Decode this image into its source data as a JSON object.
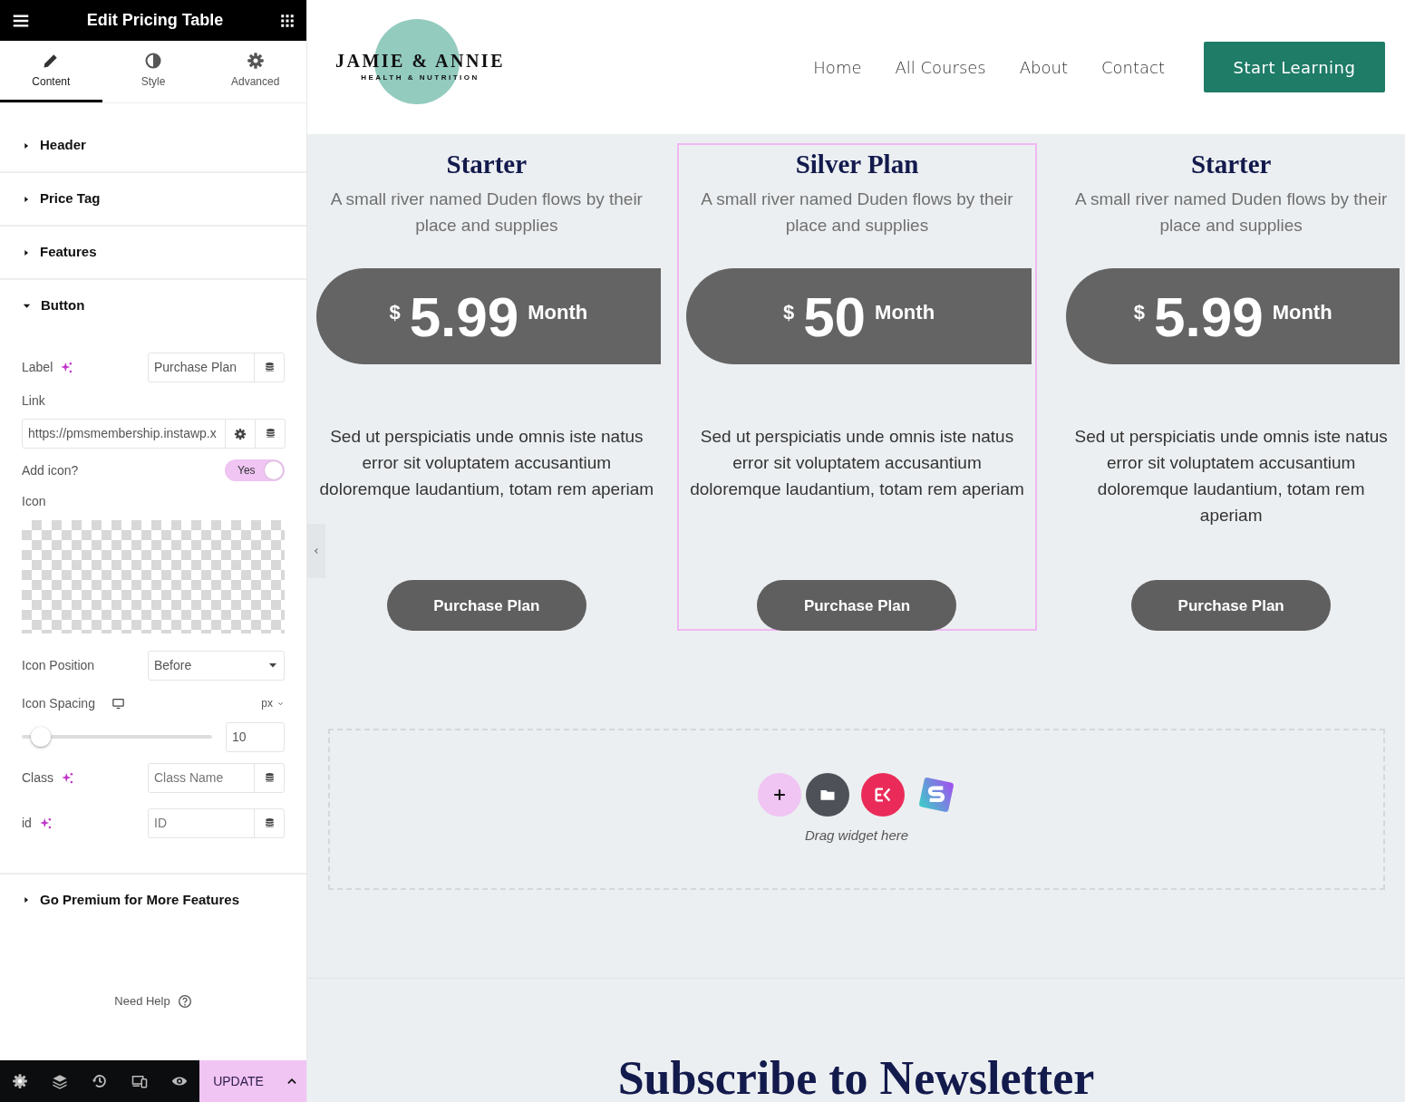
{
  "panel": {
    "title": "Edit Pricing Table",
    "tabs": [
      {
        "label": "Content",
        "kind": "pencil",
        "selected": true
      },
      {
        "label": "Style",
        "kind": "contrast",
        "selected": false
      },
      {
        "label": "Advanced",
        "kind": "gear",
        "selected": false
      }
    ],
    "sections": [
      {
        "title": "Header",
        "expanded": false
      },
      {
        "title": "Price Tag",
        "expanded": false
      },
      {
        "title": "Features",
        "expanded": false
      },
      {
        "title": "Button",
        "expanded": true
      }
    ],
    "button_controls": {
      "label": {
        "label": "Label",
        "value": "Purchase Plan"
      },
      "link": {
        "label": "Link",
        "value": "https://pmsmembership.instawp.x"
      },
      "add_icon": {
        "label": "Add icon?",
        "on": true,
        "text": "Yes"
      },
      "icon": {
        "label": "Icon"
      },
      "icon_position": {
        "label": "Icon Position",
        "value": "Before"
      },
      "icon_spacing": {
        "label": "Icon Spacing",
        "unit": "px",
        "value": "10",
        "level": 0.1
      },
      "class": {
        "label": "Class",
        "placeholder": "Class Name"
      },
      "id": {
        "label": "id",
        "placeholder": "ID"
      }
    },
    "premium": {
      "title": "Go Premium for More Features",
      "expanded": false
    },
    "help": "Need Help",
    "update": "UPDATE"
  },
  "site": {
    "logo": {
      "name": "JAMIE & ANNIE",
      "tagline": "HEALTH & NUTRITION"
    },
    "nav": [
      "Home",
      "All Courses",
      "About",
      "Contact"
    ],
    "cta": "Start Learning",
    "plans": [
      {
        "title": "Starter",
        "description": "A small river named Duden flows by their place and supplies",
        "currency": "$",
        "price": "5.99",
        "period": "Month",
        "features": "Sed ut perspiciatis unde omnis iste natus error sit voluptatem accusantium doloremque laudantium, totam rem aperiam",
        "button": "Purchase Plan",
        "selected": false
      },
      {
        "title": "Silver Plan",
        "description": "A small river named Duden flows by their place and supplies",
        "currency": "$",
        "price": "50",
        "period": "Month",
        "features": "Sed ut perspiciatis unde omnis iste natus error sit voluptatem accusantium doloremque laudantium, totam rem aperiam",
        "button": "Purchase Plan",
        "selected": true
      },
      {
        "title": "Starter",
        "description": "A small river named Duden flows by their place and supplies",
        "currency": "$",
        "price": "5.99",
        "period": "Month",
        "features": "Sed ut perspiciatis unde omnis iste natus error sit voluptatem accusantium doloremque laudantium, totam rem aperiam",
        "button": "Purchase Plan",
        "selected": false
      }
    ],
    "drop_zone": {
      "hint": "Drag widget here"
    },
    "newsletter_title": "Subscribe to Newsletter"
  }
}
